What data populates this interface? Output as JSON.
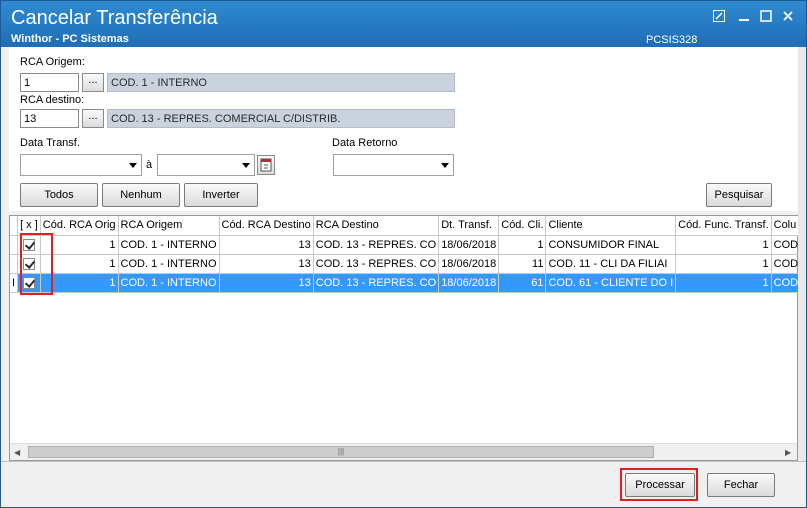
{
  "window": {
    "title": "Cancelar Transferência",
    "subtitle": "Winthor - PC Sistemas",
    "code": "PCSIS328"
  },
  "form": {
    "rca_origem_label": "RCA Origem:",
    "rca_origem_value": "1",
    "rca_origem_desc": "COD. 1 - INTERNO",
    "rca_destino_label": "RCA destino:",
    "rca_destino_value": "13",
    "rca_destino_desc": "COD. 13 - REPRES. COMERCIAL C/DISTRIB.",
    "ellipsis": "...",
    "data_transf_label": "Data Transf.",
    "a_label": "à",
    "data_retorno_label": "Data Retorno"
  },
  "buttons": {
    "todos": "Todos",
    "nenhum": "Nenhum",
    "inverter": "Inverter",
    "pesquisar": "Pesquisar",
    "processar": "Processar",
    "fechar": "Fechar"
  },
  "grid": {
    "columns": [
      "[ x ]",
      "Cód. RCA Orig",
      "RCA Origem",
      "Cód. RCA Destino",
      "RCA Destino",
      "Dt. Transf.",
      "Cód. Cli.",
      "Cliente",
      "Cód. Func. Transf.",
      "Colu"
    ],
    "rows": [
      {
        "cod_orig": "1",
        "rca_orig": "COD. 1 - INTERNO",
        "cod_dest": "13",
        "rca_dest": "COD. 13 - REPRES. CO",
        "dt": "18/06/2018",
        "cod_cli": "1",
        "cliente": "CONSUMIDOR FINAL",
        "cod_func": "1",
        "col": "COD"
      },
      {
        "cod_orig": "1",
        "rca_orig": "COD. 1 - INTERNO",
        "cod_dest": "13",
        "rca_dest": "COD. 13 - REPRES. CO",
        "dt": "18/06/2018",
        "cod_cli": "11",
        "cliente": "COD. 11 - CLI DA FILIAI",
        "cod_func": "1",
        "col": "COD"
      },
      {
        "cod_orig": "1",
        "rca_orig": "COD. 1 - INTERNO",
        "cod_dest": "13",
        "rca_dest": "COD. 13 - REPRES. CO",
        "dt": "18/06/2018",
        "cod_cli": "61",
        "cliente": "COD. 61 - CLIENTE DO I",
        "cod_func": "1",
        "col": "COD"
      }
    ],
    "row_indicator": "I"
  },
  "icons": {
    "maximize": "maximize-icon",
    "minimize": "minimize-icon",
    "restore": "restore-icon",
    "close": "close-icon",
    "calendar": "calendar-icon"
  },
  "colors": {
    "titlebar": "#1f6db6",
    "selection": "#3399ff",
    "highlight_box": "#e02020",
    "description_field": "#c9d2dd"
  }
}
